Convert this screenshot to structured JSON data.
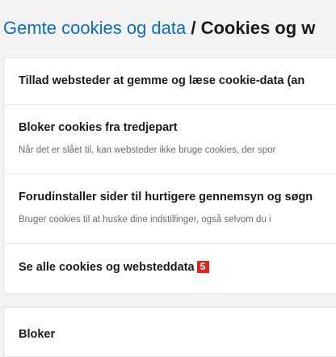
{
  "breadcrumb": {
    "parent": "Gemte cookies og data",
    "separator": " / ",
    "current": "Cookies og w"
  },
  "settings": {
    "allow_cookies": {
      "title": "Tillad websteder at gemme og læse cookie-data (an"
    },
    "block_third_party": {
      "title": "Bloker cookies fra tredjepart",
      "desc": "Når det er slået til, kan websteder ikke bruge cookies, der spor"
    },
    "preload": {
      "title": "Forudinstaller sider til hurtigere gennemsyn og søgn",
      "desc": "Bruger cookies til at huske dine indstillinger, også selvom du i"
    },
    "see_all": {
      "title": "Se alle cookies og websteddata",
      "badge": "5"
    }
  },
  "block_section": {
    "title": "Bloker"
  },
  "colors": {
    "link": "#0b6cbf",
    "badge": "#d8291f",
    "background": "#f3f3f3"
  }
}
